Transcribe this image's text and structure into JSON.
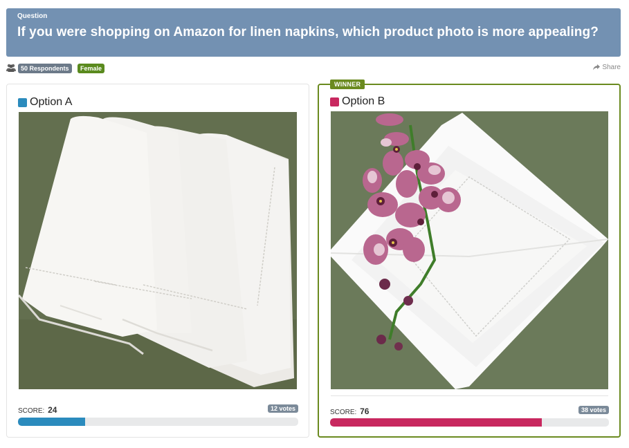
{
  "question": {
    "label": "Question",
    "text": "If you were shopping on Amazon for linen napkins, which product photo is more appealing?"
  },
  "meta": {
    "respondents_icon": "people-icon",
    "respondents": "50 Respondents",
    "gender": "Female",
    "share_icon": "share-arrow-icon",
    "share_label": "Share"
  },
  "options": [
    {
      "title": "Option A",
      "color": "#2b8bbd",
      "score_label": "SCORE:",
      "score": "24",
      "score_fraction": 0.24,
      "votes": "12 votes",
      "winner": false
    },
    {
      "title": "Option B",
      "color": "#c8285f",
      "score_label": "SCORE:",
      "score": "76",
      "score_fraction": 0.76,
      "votes": "38 votes",
      "winner": true,
      "winner_label": "WINNER"
    }
  ],
  "colors": {
    "banner": "#7391b2",
    "winner_border": "#6a8a1f",
    "respondents_badge": "#6c7a89",
    "gender_badge": "#5a8a1e"
  }
}
